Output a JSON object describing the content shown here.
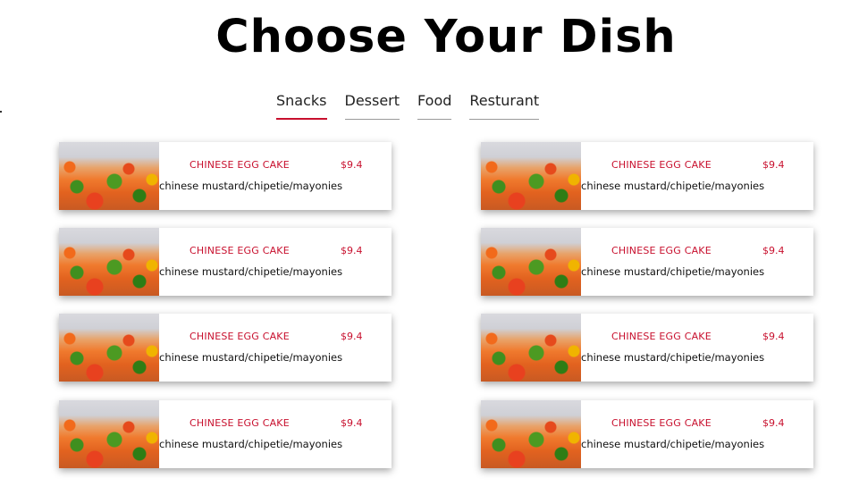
{
  "page_title": "Choose Your Dish",
  "tabs": [
    {
      "label": "Snacks",
      "active": true
    },
    {
      "label": "Dessert",
      "active": false
    },
    {
      "label": "Food",
      "active": false
    },
    {
      "label": "Resturant",
      "active": false
    }
  ],
  "colors": {
    "accent": "#c8102e",
    "text": "#111111",
    "tab_underline": "#9a9a9a"
  },
  "dishes": [
    {
      "name": "CHINESE EGG CAKE",
      "price": "$9.4",
      "description": "chinese mustard/chipetie/mayonies",
      "image_icon": "food-photo"
    },
    {
      "name": "CHINESE EGG CAKE",
      "price": "$9.4",
      "description": "chinese mustard/chipetie/mayonies",
      "image_icon": "food-photo"
    },
    {
      "name": "CHINESE EGG CAKE",
      "price": "$9.4",
      "description": "chinese mustard/chipetie/mayonies",
      "image_icon": "food-photo"
    },
    {
      "name": "CHINESE EGG CAKE",
      "price": "$9.4",
      "description": "chinese mustard/chipetie/mayonies",
      "image_icon": "food-photo"
    },
    {
      "name": "CHINESE EGG CAKE",
      "price": "$9.4",
      "description": "chinese mustard/chipetie/mayonies",
      "image_icon": "food-photo"
    },
    {
      "name": "CHINESE EGG CAKE",
      "price": "$9.4",
      "description": "chinese mustard/chipetie/mayonies",
      "image_icon": "food-photo"
    },
    {
      "name": "CHINESE EGG CAKE",
      "price": "$9.4",
      "description": "chinese mustard/chipetie/mayonies",
      "image_icon": "food-photo"
    },
    {
      "name": "CHINESE EGG CAKE",
      "price": "$9.4",
      "description": "chinese mustard/chipetie/mayonies",
      "image_icon": "food-photo"
    }
  ]
}
